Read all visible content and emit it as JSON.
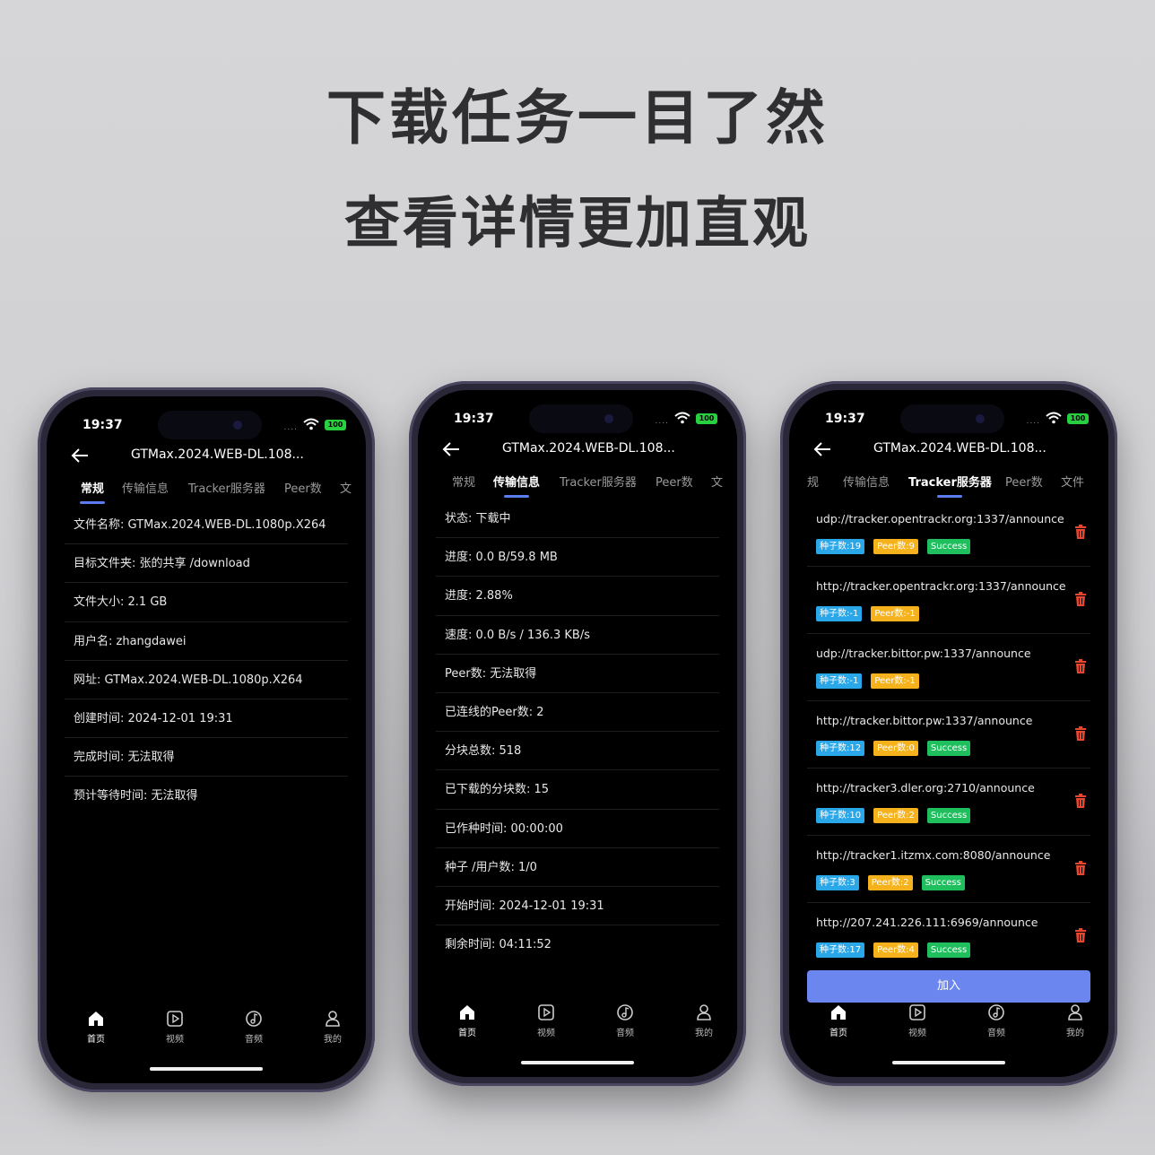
{
  "headline": {
    "line1": "下载任务一目了然",
    "line2": "查看详情更加直观"
  },
  "status": {
    "time": "19:37",
    "signal": "....",
    "battery": "100"
  },
  "app": {
    "title": "GTMax.2024.WEB-DL.108...",
    "tabs": [
      "常规",
      "传输信息",
      "Tracker服务器",
      "Peer数",
      "文件"
    ],
    "nav": [
      "首页",
      "视频",
      "音频",
      "我的"
    ]
  },
  "phone1": {
    "tabs_visible": [
      "常规",
      "传输信息",
      "Tracker服务器",
      "Peer数",
      "文"
    ],
    "rows": [
      "文件名称: GTMax.2024.WEB-DL.1080p.X264",
      "目标文件夹: 张的共享 /download",
      "文件大小: 2.1 GB",
      "用户名: zhangdawei",
      "网址: GTMax.2024.WEB-DL.1080p.X264",
      "创建时间: 2024-12-01 19:31",
      "完成时间: 无法取得",
      "预计等待时间: 无法取得"
    ]
  },
  "phone2": {
    "tabs_visible": [
      "常规",
      "传输信息",
      "Tracker服务器",
      "Peer数",
      "文"
    ],
    "rows": [
      "状态: 下载中",
      "进度: 0.0 B/59.8 MB",
      "进度: 2.88%",
      "速度: 0.0 B/s / 136.3 KB/s",
      "Peer数: 无法取得",
      "已连线的Peer数: 2",
      "分块总数: 518",
      "已下载的分块数: 15",
      "已作种时间: 00:00:00",
      "种子 /用户数: 1/0",
      "开始时间: 2024-12-01 19:31",
      "剩余时间: 04:11:52"
    ]
  },
  "phone3": {
    "tabs_visible": [
      "规",
      "传输信息",
      "Tracker服务器",
      "Peer数",
      "文件"
    ],
    "trackers": [
      {
        "url": "udp://tracker.opentrackr.org:1337/announce",
        "seed": "种子数:19",
        "peer": "Peer数:9",
        "status": "Success"
      },
      {
        "url": "http://tracker.opentrackr.org:1337/announce",
        "seed": "种子数:-1",
        "peer": "Peer数:-1",
        "status": ""
      },
      {
        "url": "udp://tracker.bittor.pw:1337/announce",
        "seed": "种子数:-1",
        "peer": "Peer数:-1",
        "status": ""
      },
      {
        "url": "http://tracker.bittor.pw:1337/announce",
        "seed": "种子数:12",
        "peer": "Peer数:0",
        "status": "Success"
      },
      {
        "url": "http://tracker3.dler.org:2710/announce",
        "seed": "种子数:10",
        "peer": "Peer数:2",
        "status": "Success"
      },
      {
        "url": "http://tracker1.itzmx.com:8080/announce",
        "seed": "种子数:3",
        "peer": "Peer数:2",
        "status": "Success"
      },
      {
        "url": "http://207.241.226.111:6969/announce",
        "seed": "种子数:17",
        "peer": "Peer数:4",
        "status": "Success"
      }
    ],
    "join_label": "加入"
  },
  "colors": {
    "accent": "#6b87ef",
    "seed_tag": "#2aa7e8",
    "peer_tag": "#f5b21c",
    "success_tag": "#1fbf5e",
    "trash": "#e8462e"
  }
}
